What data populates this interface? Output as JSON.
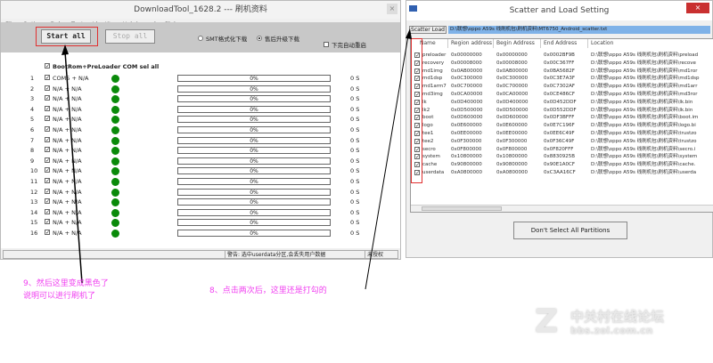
{
  "left_window": {
    "title": "DownloadTool_1628.2 --- 刷机资料",
    "close": "×",
    "menu": [
      "File",
      "Option",
      "Debug TooL",
      "Identity",
      "Help(open log file)"
    ],
    "start_all": "Start all",
    "stop_all": "Stop all",
    "radio_smt": "SMT格式化下载",
    "radio_upgrade": "售后升级下载",
    "auto_reboot": "下完自动重启",
    "sel_all": "BootRom+PreLoader COM sel all",
    "rows": [
      {
        "n": "1",
        "port": "COM5 + N/A",
        "progress": "0%",
        "time": "0 S"
      },
      {
        "n": "2",
        "port": "N/A + N/A",
        "progress": "0%",
        "time": "0 S"
      },
      {
        "n": "3",
        "port": "N/A + N/A",
        "progress": "0%",
        "time": "0 S"
      },
      {
        "n": "4",
        "port": "N/A + N/A",
        "progress": "0%",
        "time": "0 S"
      },
      {
        "n": "5",
        "port": "N/A + N/A",
        "progress": "0%",
        "time": "0 S"
      },
      {
        "n": "6",
        "port": "N/A + N/A",
        "progress": "0%",
        "time": "0 S"
      },
      {
        "n": "7",
        "port": "N/A + N/A",
        "progress": "0%",
        "time": "0 S"
      },
      {
        "n": "8",
        "port": "N/A + N/A",
        "progress": "0%",
        "time": "0 S"
      },
      {
        "n": "9",
        "port": "N/A + N/A",
        "progress": "0%",
        "time": "0 S"
      },
      {
        "n": "10",
        "port": "N/A + N/A",
        "progress": "0%",
        "time": "0 S"
      },
      {
        "n": "11",
        "port": "N/A + N/A",
        "progress": "0%",
        "time": "0 S"
      },
      {
        "n": "12",
        "port": "N/A + N/A",
        "progress": "0%",
        "time": "0 S"
      },
      {
        "n": "13",
        "port": "N/A + N/A",
        "progress": "0%",
        "time": "0 S"
      },
      {
        "n": "14",
        "port": "N/A + N/A",
        "progress": "0%",
        "time": "0 S"
      },
      {
        "n": "15",
        "port": "N/A + N/A",
        "progress": "0%",
        "time": "0 S"
      },
      {
        "n": "16",
        "port": "N/A + N/A",
        "progress": "0%",
        "time": "0 S"
      }
    ],
    "status_warning": "警告: 选中userdata分区,会丢失用户数据",
    "status_auth": "未授权"
  },
  "right_window": {
    "title": "Scatter and Load Setting",
    "close": "×",
    "scatter_load": "Scatter Load",
    "scatter_path": "D:\\联想\\oppo A59s 线刷机包\\刷机资料\\MT6750_Android_scatter.txt",
    "columns": [
      "Name",
      "Region address",
      "Begin Address",
      "End Address",
      "Location"
    ],
    "rows": [
      [
        "preloader",
        "0x00000000",
        "0x00000000",
        "0x0002BF9B",
        "D:\\联想\\oppo A59s 线刷机包\\刷机资料\\preload"
      ],
      [
        "recovery",
        "0x00008000",
        "0x00008000",
        "0x00C367FF",
        "D:\\联想\\oppo A59s 线刷机包\\刷机资料\\recove"
      ],
      [
        "md1img",
        "0x0AB00000",
        "0x0AB00000",
        "0x0BA5682F",
        "D:\\联想\\oppo A59s 线刷机包\\刷机资料\\md1ror"
      ],
      [
        "md1dsp",
        "0x0C300000",
        "0x0C300000",
        "0x0C3E7A3F",
        "D:\\联想\\oppo A59s 线刷机包\\刷机资料\\md1dsp"
      ],
      [
        "md1arm7",
        "0x0C700000",
        "0x0C700000",
        "0x0C7302AF",
        "D:\\联想\\oppo A59s 线刷机包\\刷机资料\\md1arr"
      ],
      [
        "md3img",
        "0x0CA00000",
        "0x0CA00000",
        "0x0CE486CF",
        "D:\\联想\\oppo A59s 线刷机包\\刷机资料\\md3ror"
      ],
      [
        "lk",
        "0x0D400000",
        "0x0D400000",
        "0x0D452DDF",
        "D:\\联想\\oppo A59s 线刷机包\\刷机资料\\lk.bin"
      ],
      [
        "lk2",
        "0x0D500000",
        "0x0D500000",
        "0x0D552DDF",
        "D:\\联想\\oppo A59s 线刷机包\\刷机资料\\lk.bin"
      ],
      [
        "boot",
        "0x0D600000",
        "0x0D600000",
        "0x0DF3BFFF",
        "D:\\联想\\oppo A59s 线刷机包\\刷机资料\\boot.im"
      ],
      [
        "logo",
        "0x0E600000",
        "0x0E600000",
        "0x0E7C196F",
        "D:\\联想\\oppo A59s 线刷机包\\刷机资料\\logo.bi"
      ],
      [
        "tee1",
        "0x0EE00000",
        "0x0EE00000",
        "0x0EE6C49F",
        "D:\\联想\\oppo A59s 线刷机包\\刷机资料\\trustzo"
      ],
      [
        "tee2",
        "0x0F300000",
        "0x0F300000",
        "0x0F36C49F",
        "D:\\联想\\oppo A59s 线刷机包\\刷机资料\\trustzo"
      ],
      [
        "secro",
        "0x0F800000",
        "0x0F800000",
        "0x0F820FFF",
        "D:\\联想\\oppo A59s 线刷机包\\刷机资料\\secro.i"
      ],
      [
        "system",
        "0x10800000",
        "0x10800000",
        "0x8830925B",
        "D:\\联想\\oppo A59s 线刷机包\\刷机资料\\system"
      ],
      [
        "cache",
        "0x90800000",
        "0x90800000",
        "0x90E1A0CF",
        "D:\\联想\\oppo A59s 线刷机包\\刷机资料\\cache."
      ],
      [
        "userdata",
        "0xA0800000",
        "0xA0800000",
        "0xC3AA16CF",
        "D:\\联想\\oppo A59s 线刷机包\\刷机资料\\userda"
      ]
    ],
    "dont_select_all": "Don't Select All Partitions"
  },
  "annotations": {
    "note9_line1": "9、然后这里变成黑色了",
    "note9_line2": "说明可以进行刷机了",
    "note8": "8、点击两次后，这里还是打勾的"
  },
  "watermark": {
    "line1": "中关村在线论坛",
    "line2": "bbs.zol.com.cn"
  },
  "colors": {
    "annotation": "#f040f0",
    "highlight": "#e03030",
    "led": "#0a8a0a"
  }
}
